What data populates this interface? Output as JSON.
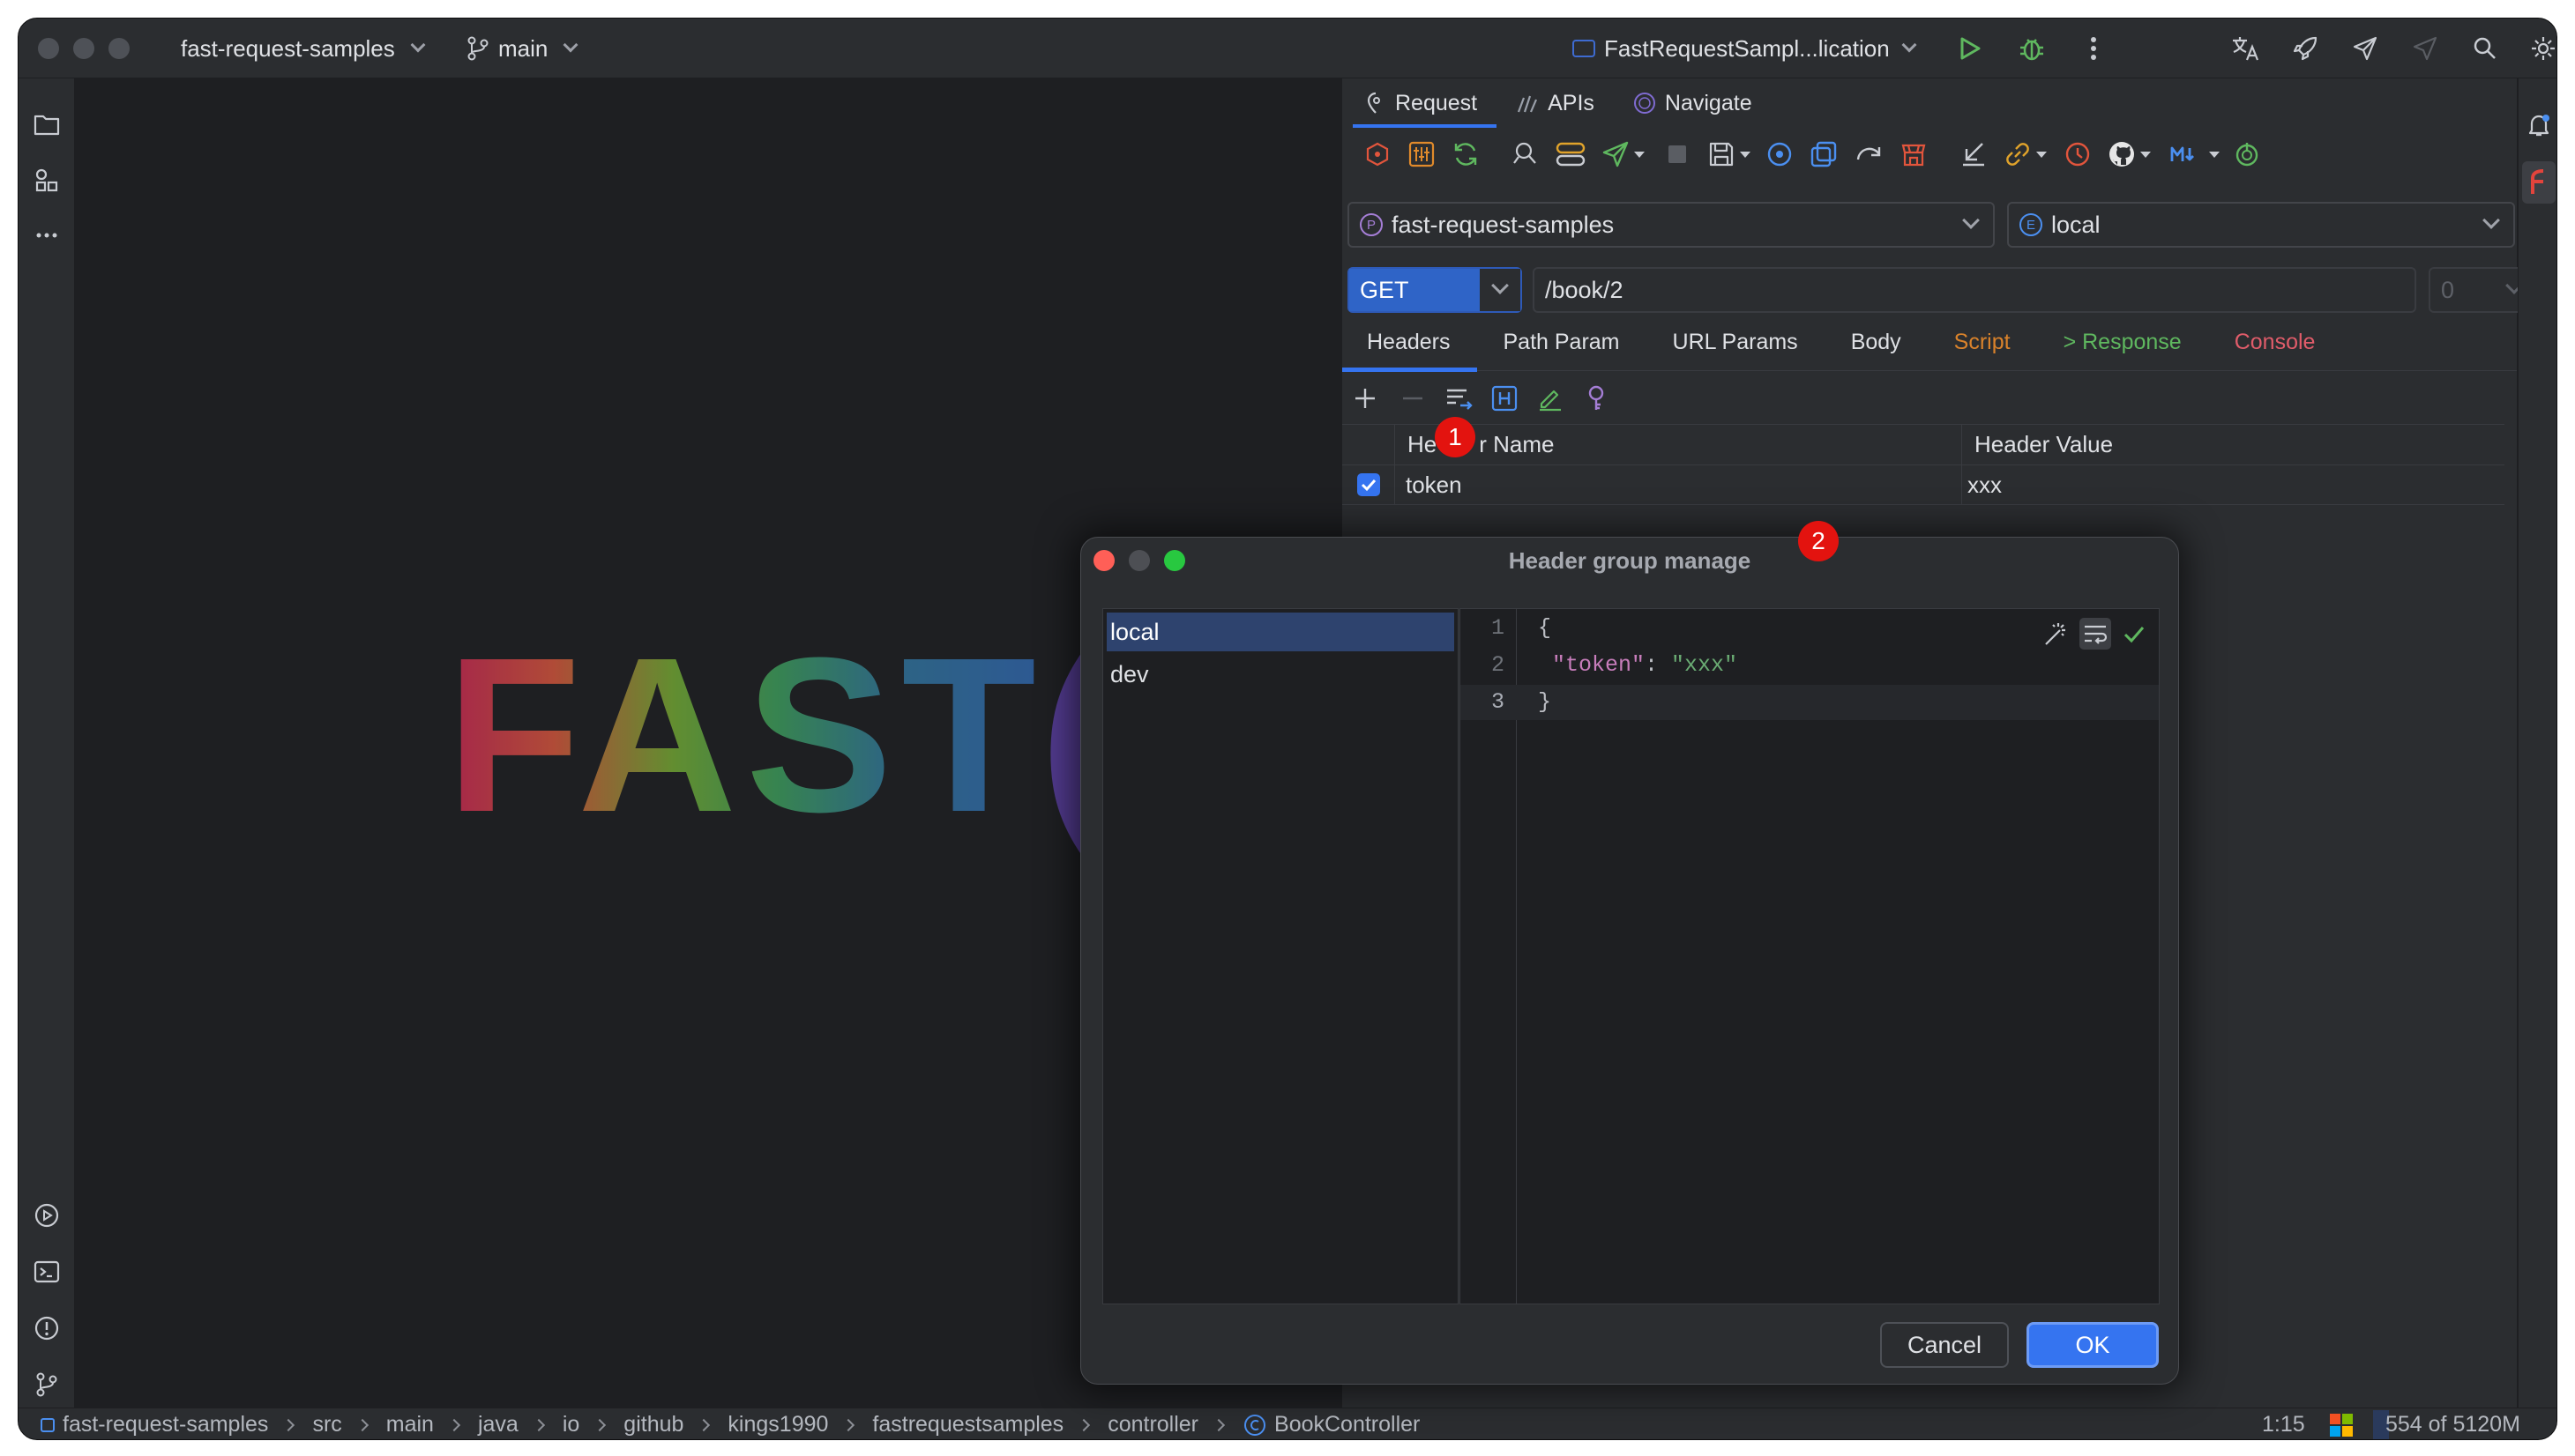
{
  "titlebar": {
    "project": "fast-request-samples",
    "branch": "main",
    "run_config": "FastRequestSampl...lication"
  },
  "panel": {
    "tabs": [
      {
        "label": "Request",
        "icon": "request-icon"
      },
      {
        "label": "APIs",
        "icon": "apis-icon"
      },
      {
        "label": "Navigate",
        "icon": "navigate-icon"
      }
    ],
    "project_combo": {
      "badge": "P",
      "value": "fast-request-samples"
    },
    "env_combo": {
      "badge": "E",
      "value": "local"
    },
    "method": "GET",
    "url": "/book/2",
    "count_combo": "0",
    "subtabs": [
      {
        "label": "Headers",
        "color": "#dfe1e5"
      },
      {
        "label": "Path Param",
        "color": "#dfe1e5"
      },
      {
        "label": "URL Params",
        "color": "#dfe1e5"
      },
      {
        "label": "Body",
        "color": "#dfe1e5"
      },
      {
        "label": "Script",
        "color": "#d9822b"
      },
      {
        "label": "> Response",
        "color": "#5fb85f"
      },
      {
        "label": "Console",
        "color": "#e05c6a"
      }
    ],
    "table": {
      "col_name": "Header Name",
      "col_name_visible_left": "He",
      "col_name_visible_right": "r Name",
      "col_value": "Header Value",
      "rows": [
        {
          "checked": true,
          "name": "token",
          "value": "xxx"
        }
      ]
    }
  },
  "annotations": {
    "badge1": "1",
    "badge2": "2"
  },
  "editor": {
    "logo_text": "FAST"
  },
  "dialog": {
    "title": "Header group manage",
    "groups": [
      "local",
      "dev"
    ],
    "selected_group": "local",
    "code_lines": [
      {
        "num": "1",
        "text": "{"
      },
      {
        "num": "2",
        "key": "\"token\"",
        "colon": ": ",
        "value": "\"xxx\""
      },
      {
        "num": "3",
        "text": "}"
      }
    ],
    "cancel": "Cancel",
    "ok": "OK"
  },
  "statusbar": {
    "breadcrumb": [
      "fast-request-samples",
      "src",
      "main",
      "java",
      "io",
      "github",
      "kings1990",
      "fastrequestsamples",
      "controller",
      "BookController"
    ],
    "position": "1:15",
    "memory": "554 of 5120M"
  },
  "colors": {
    "accent": "#3574f0",
    "background": "#1e1f22",
    "panel": "#2b2d30",
    "badge_red": "#e3130f",
    "json_key": "#c77dbb",
    "json_string": "#6aab73"
  }
}
